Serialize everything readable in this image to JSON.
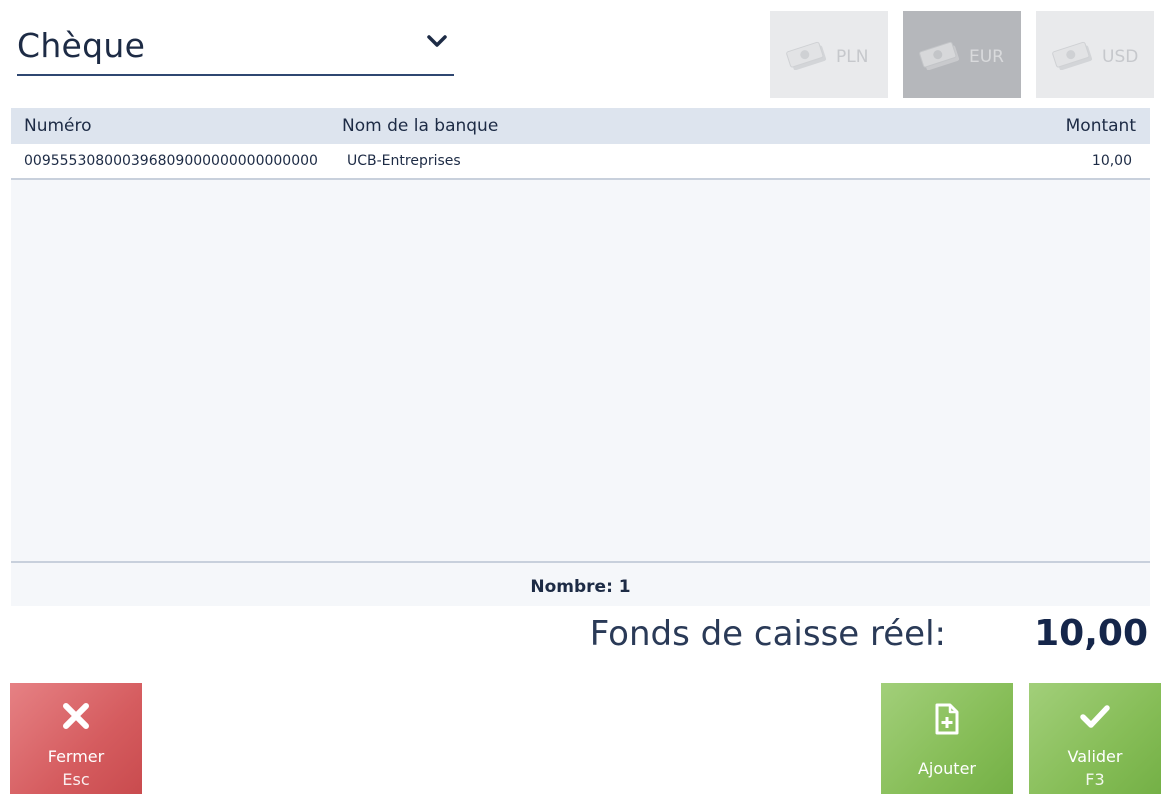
{
  "payment_type": {
    "selected": "Chèque"
  },
  "currencies": [
    {
      "code": "PLN",
      "selected": false
    },
    {
      "code": "EUR",
      "selected": true
    },
    {
      "code": "USD",
      "selected": false
    }
  ],
  "table": {
    "headers": {
      "number": "Numéro",
      "bank_name": "Nom de la banque",
      "amount": "Montant"
    },
    "rows": [
      {
        "number": "009555308000396809000000000000000",
        "bank_name": "UCB-Entreprises",
        "amount": "10,00"
      }
    ],
    "footer": {
      "count_label": "Nombre:  1"
    }
  },
  "total": {
    "label": "Fonds de caisse réel:",
    "value": "10,00"
  },
  "actions": {
    "close": {
      "label": "Fermer",
      "shortcut": "Esc",
      "icon": "close-icon"
    },
    "add": {
      "label": "Ajouter",
      "icon": "add-document-icon"
    },
    "validate": {
      "label": "Valider",
      "shortcut": "F3",
      "icon": "checkmark-icon"
    }
  },
  "colors": {
    "close_button": "#d55c5f",
    "confirm_button": "#86bd57",
    "header_row": "#dde4ee",
    "text_primary": "#1d2b45"
  }
}
